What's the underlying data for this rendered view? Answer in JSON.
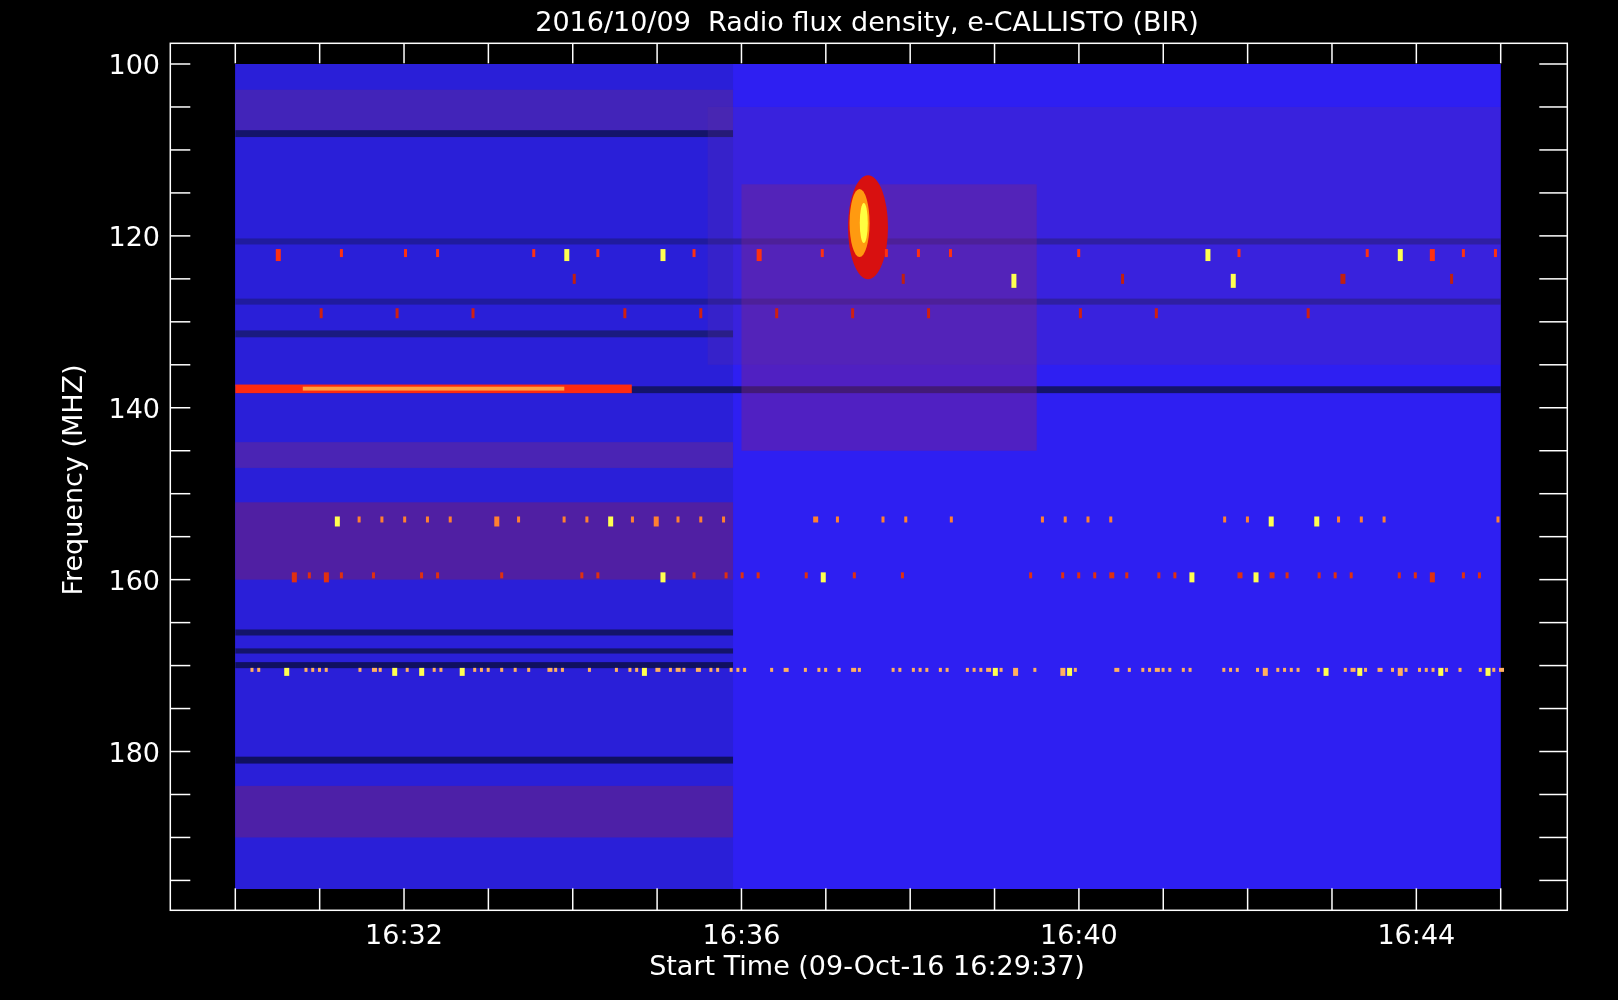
{
  "title": "2016/10/09  Radio flux density, e-CALLISTO (BIR)",
  "y_axis": {
    "label": "Frequency (MHZ)",
    "ticks": [
      "100",
      "120",
      "140",
      "160",
      "180"
    ]
  },
  "x_axis": {
    "label": "Start Time (09-Oct-16 16:29:37)",
    "ticks": [
      "16:32",
      "16:36",
      "16:40",
      "16:44"
    ]
  }
}
